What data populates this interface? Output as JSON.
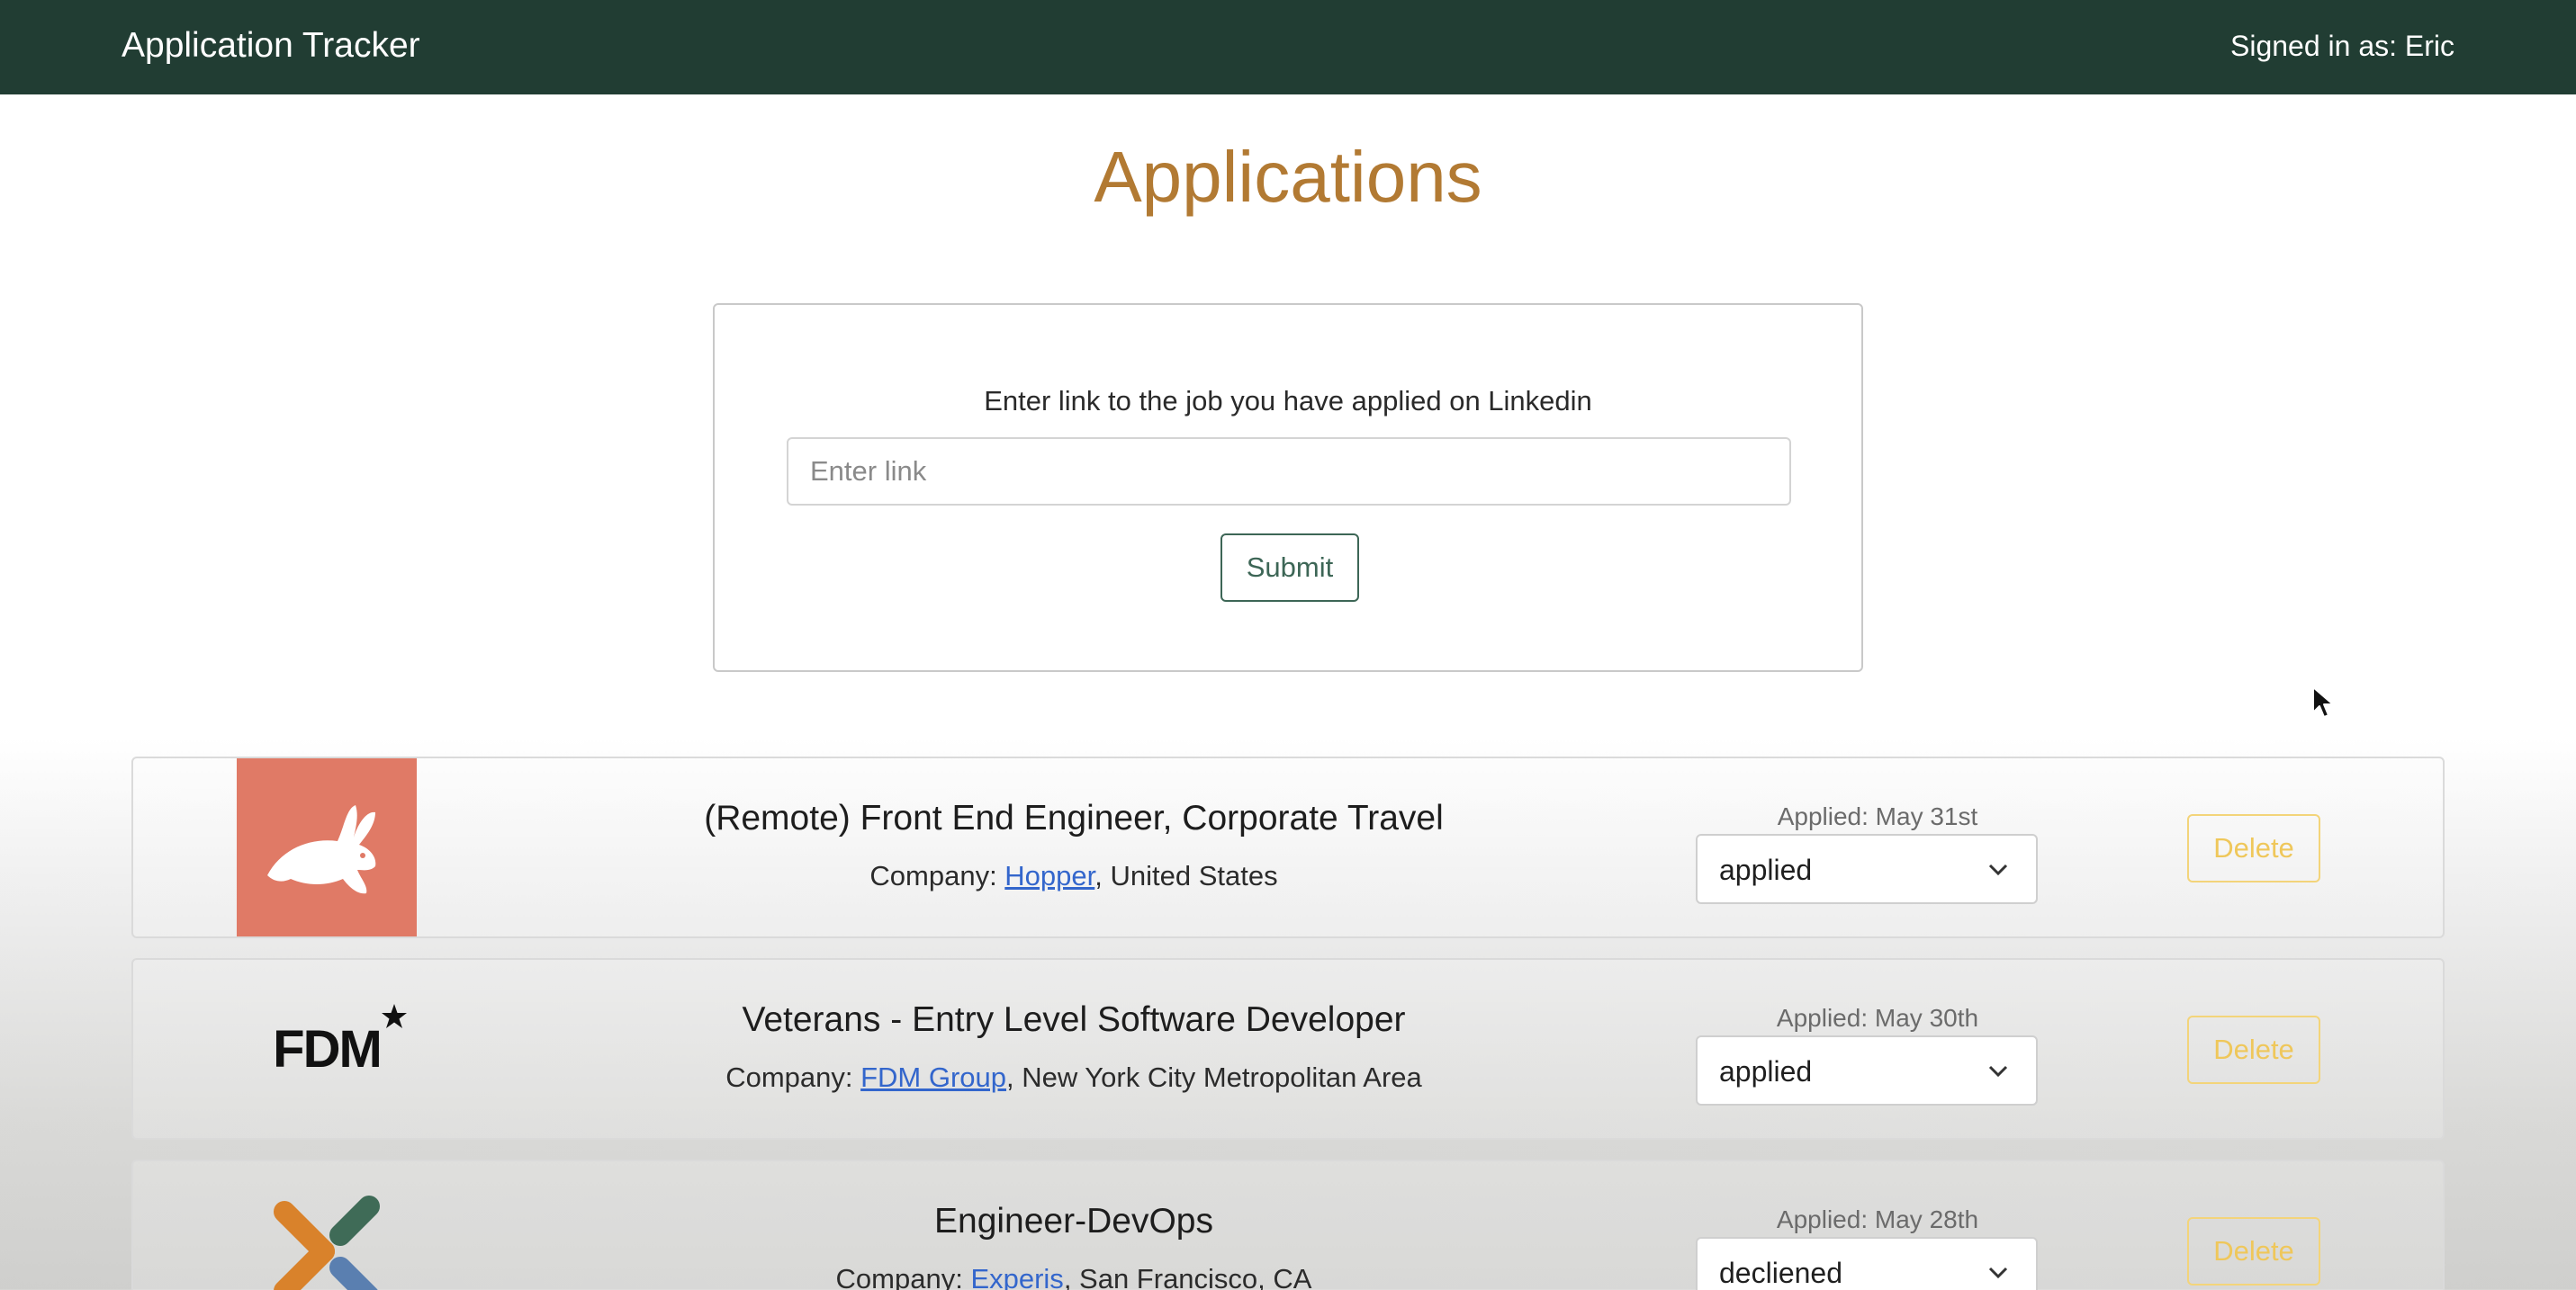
{
  "navbar": {
    "brand": "Application Tracker",
    "signed_in": "Signed in as: Eric",
    "background": "#213d33"
  },
  "page": {
    "title": "Applications",
    "title_color": "#b27a33"
  },
  "link_form": {
    "prompt": "Enter link to the job you have applied on Linkedin",
    "placeholder": "Enter link",
    "value": "",
    "submit_label": "Submit"
  },
  "applications": [
    {
      "logo": "hopper-bunny-icon",
      "logo_color": "#e07a66",
      "title": "(Remote) Front End Engineer, Corporate Travel",
      "company_prefix": "Company: ",
      "company": "Hopper",
      "location": ", United States",
      "applied": "Applied: May 31st",
      "status": "applied",
      "delete_label": "Delete"
    },
    {
      "logo": "fdm-logo",
      "logo_text": "FDM",
      "title": "Veterans - Entry Level Software Developer",
      "company_prefix": "Company: ",
      "company": "FDM Group",
      "location": ", New York City Metropolitan Area",
      "applied": "Applied: May 30th",
      "status": "applied",
      "delete_label": "Delete"
    },
    {
      "logo": "experis-x-logo",
      "title": "Engineer-DevOps",
      "company_prefix": "Company: ",
      "company": "Experis",
      "location": ", San Francisco, CA",
      "applied": "Applied: May 28th",
      "status": "decliened",
      "delete_label": "Delete"
    }
  ]
}
